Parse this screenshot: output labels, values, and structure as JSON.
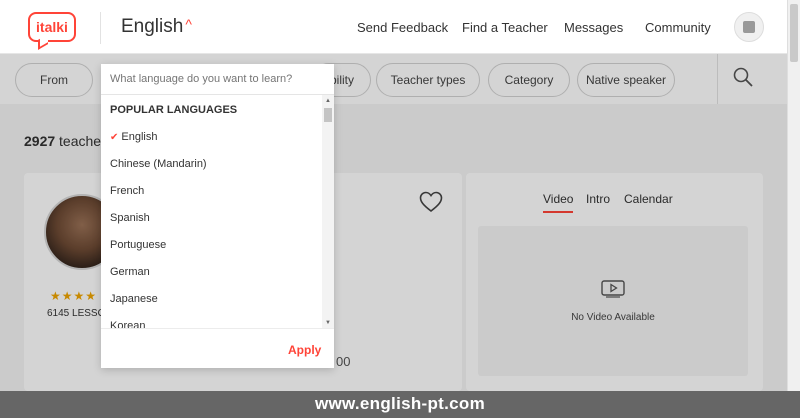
{
  "header": {
    "logo_text": "italki",
    "language_label": "English",
    "caret": "^",
    "nav": [
      "Send Feedback",
      "Find a Teacher",
      "Messages",
      "Community"
    ]
  },
  "filters": {
    "pills": [
      "From",
      "bility",
      "Teacher types",
      "Category",
      "Native speaker"
    ]
  },
  "results": {
    "count": "2927",
    "count_suffix": "teache"
  },
  "teacher_card": {
    "stars": "★★★★",
    "lessons": "6145 LESSO",
    "price_fragment": "00"
  },
  "video_card": {
    "tabs": [
      "Video",
      "Intro",
      "Calendar"
    ],
    "active_tab": "Video",
    "empty_text": "No Video Available"
  },
  "dropdown": {
    "search_placeholder": "What language do you want to learn?",
    "heading": "POPULAR LANGUAGES",
    "selected": "English",
    "items": [
      "English",
      "Chinese (Mandarin)",
      "French",
      "Spanish",
      "Portuguese",
      "German",
      "Japanese",
      "Korean"
    ],
    "apply_label": "Apply"
  },
  "watermark": "www.english-pt.com",
  "colors": {
    "accent": "#ff4438",
    "star": "#f0a500"
  }
}
